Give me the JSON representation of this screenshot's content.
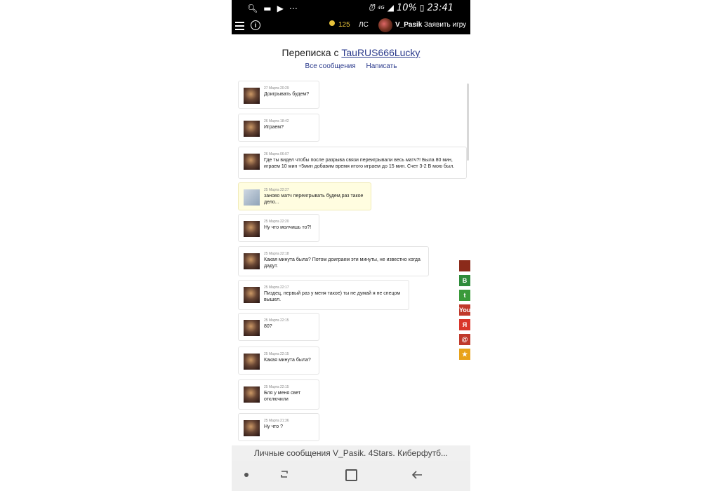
{
  "status_bar": {
    "battery": "10%",
    "time": "23:41",
    "network": "4G"
  },
  "header": {
    "coins": "125",
    "ls_label": "ЛС",
    "username": "V_Pasik",
    "declare_label": "Заявить игру"
  },
  "page": {
    "title_prefix": "Переписка с",
    "title_user": "TauRUS666Lucky",
    "all_messages": "Все сообщения",
    "write": "Написать"
  },
  "messages": [
    {
      "date": "27 Марта 20:29",
      "text": "Доигрывать будем?",
      "own": false
    },
    {
      "date": "26 Марта 18:42",
      "text": "Играем?",
      "own": false
    },
    {
      "date": "26 Марта 06:07",
      "text": "Где ты видел чтобы после разрыва связи переигрывали весь матч?! Была 80 мин, играем 10 мин +5мин добавим время итого играем до 15 мин. Счет 3-2 В мою был.",
      "own": false
    },
    {
      "date": "25 Марта 22:27",
      "text": "заново матч переигрывать будем,раз такое дело...",
      "own": true
    },
    {
      "date": "25 Марта 22:20",
      "text": "Ну что молчишь то?!",
      "own": false
    },
    {
      "date": "25 Марта 22:18",
      "text": "Какая минута была? Потом доиграем эти минуты, не известно когда дадут.",
      "own": false
    },
    {
      "date": "25 Марта 22:17",
      "text": "Пиздец, первый раз у меня такое) ты не думай я не спецом вышел.",
      "own": false
    },
    {
      "date": "25 Марта 22:15",
      "text": "80?",
      "own": false
    },
    {
      "date": "25 Марта 22:15",
      "text": "Какая минута была?",
      "own": false
    },
    {
      "date": "25 Марта 22:15",
      "text": "Бля у меня свет отключили",
      "own": false
    },
    {
      "date": "25 Марта 21:36",
      "text": "Ну что ?",
      "own": false
    }
  ],
  "share": [
    {
      "name": "hat",
      "label": "",
      "color": "#8b2a1a"
    },
    {
      "name": "vk",
      "label": "B",
      "color": "#2e8b3a"
    },
    {
      "name": "twitter",
      "label": "t",
      "color": "#3a9a3a"
    },
    {
      "name": "youtube",
      "label": "You",
      "color": "#c0392b"
    },
    {
      "name": "yandex",
      "label": "Я",
      "color": "#d9362b"
    },
    {
      "name": "mail",
      "label": "@",
      "color": "#c0392b"
    },
    {
      "name": "star",
      "label": "★",
      "color": "#e8a21a"
    }
  ],
  "bottom": {
    "url_text": "Личные сообщения V_Pasik. 4Stars. Киберфутб..."
  }
}
